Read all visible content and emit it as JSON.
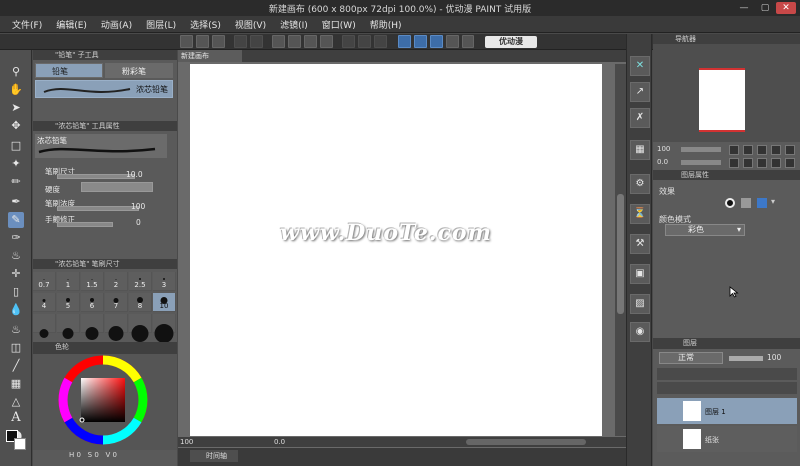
{
  "window": {
    "title": "新建画布 (600 x 800px 72dpi 100.0%) - 优动漫 PAINT 试用版",
    "minimize": "—",
    "maximize": "▢",
    "close": "✕"
  },
  "menu": [
    "文件(F)",
    "编辑(E)",
    "动画(A)",
    "图层(L)",
    "选择(S)",
    "视图(V)",
    "滤镜(I)",
    "窗口(W)",
    "帮助(H)"
  ],
  "toolbar": {
    "logo": "优动漫"
  },
  "subtool": {
    "header": "\"铅笔\" 子工具",
    "tab_pencil": "铅笔",
    "tab_colored_pencil": "粉彩笔",
    "brush_name": "浓芯铅笔",
    "props_header": "\"浓芯铅笔\" 工具属性",
    "props_brush_name": "浓芯铅笔",
    "size_label": "笔刷尺寸",
    "size_value": "10.0",
    "hardness_label": "硬度",
    "density_label": "笔刷浓度",
    "density_value": "100",
    "stabilization_label": "手颤修正",
    "stabilization_value": "0",
    "brush_size_header": "\"浓芯铅笔\" 笔刷尺寸",
    "brush_sizes": [
      "0.7",
      "1",
      "1.5",
      "2",
      "2.5",
      "3",
      "4",
      "5",
      "6",
      "7",
      "8",
      "10"
    ],
    "color_header": "色轮"
  },
  "color_values": {
    "h": "0",
    "s": "0",
    "v": "0"
  },
  "canvas": {
    "tab_name": "新建画布",
    "watermark": "www.DuoTe.com",
    "zoom": "100",
    "angle": "0.0",
    "timeline_tab": "时间轴"
  },
  "navigator": {
    "header": "导航器",
    "zoom": "100",
    "angle": "0.0"
  },
  "layer_props": {
    "header": "图层属性",
    "effect_label": "效果",
    "color_mode_label": "颜色模式",
    "color_mode_value": "彩色"
  },
  "layers": {
    "tab_label": "图层",
    "blend_mode": "正常",
    "opacity": "100",
    "layer1": "图层 1",
    "paper": "纸张"
  },
  "colors": {
    "accent_blue": "#8aa0b8",
    "panel": "#5b5b5b",
    "dark": "#3a3a3a"
  }
}
